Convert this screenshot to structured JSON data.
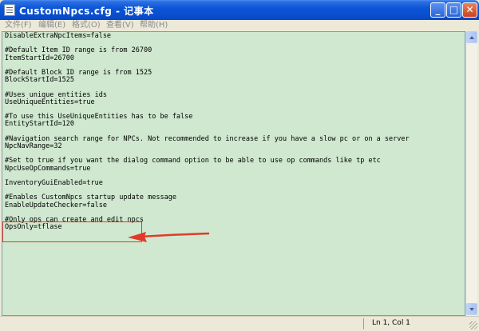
{
  "window": {
    "title": "CustomNpcs.cfg - 记事本"
  },
  "titlebar_buttons": {
    "minimize": "_",
    "maximize": "□",
    "close": "✕"
  },
  "menu": {
    "items": [
      {
        "label": "文件(F)"
      },
      {
        "label": "编辑(E)"
      },
      {
        "label": "格式(O)"
      },
      {
        "label": "查看(V)"
      },
      {
        "label": "帮助(H)"
      }
    ]
  },
  "editor": {
    "content": "DisableExtraNpcItems=false\n\n#Default Item ID range is from 26700\nItemStartId=26700\n\n#Default Block ID range is from 1525\nBlockStartId=1525\n\n#Uses unique entities ids\nUseUniqueEntities=true\n\n#To use this UseUniqueEntities has to be false\nEntityStartId=120\n\n#Navigation search range for NPCs. Not recommended to increase if you have a slow pc or on a server\nNpcNavRange=32\n\n#Set to true if you want the dialog command option to be able to use op commands like tp etc\nNpcUseOpCommands=true\n\nInventoryGuiEnabled=true\n\n#Enables CustomNpcs startup update message\nEnableUpdateChecker=false\n\n#Only ops can create and edit npcs\nOpsOnly=tflase",
    "background": "#cfe8cf"
  },
  "statusbar": {
    "position": "Ln 1, Col 1"
  },
  "annotation": {
    "color": "#e23a2a"
  },
  "icons": [
    "notepad-icon",
    "minimize-icon",
    "maximize-icon",
    "close-icon",
    "scroll-up-icon",
    "scroll-down-icon",
    "resize-grip-icon"
  ]
}
